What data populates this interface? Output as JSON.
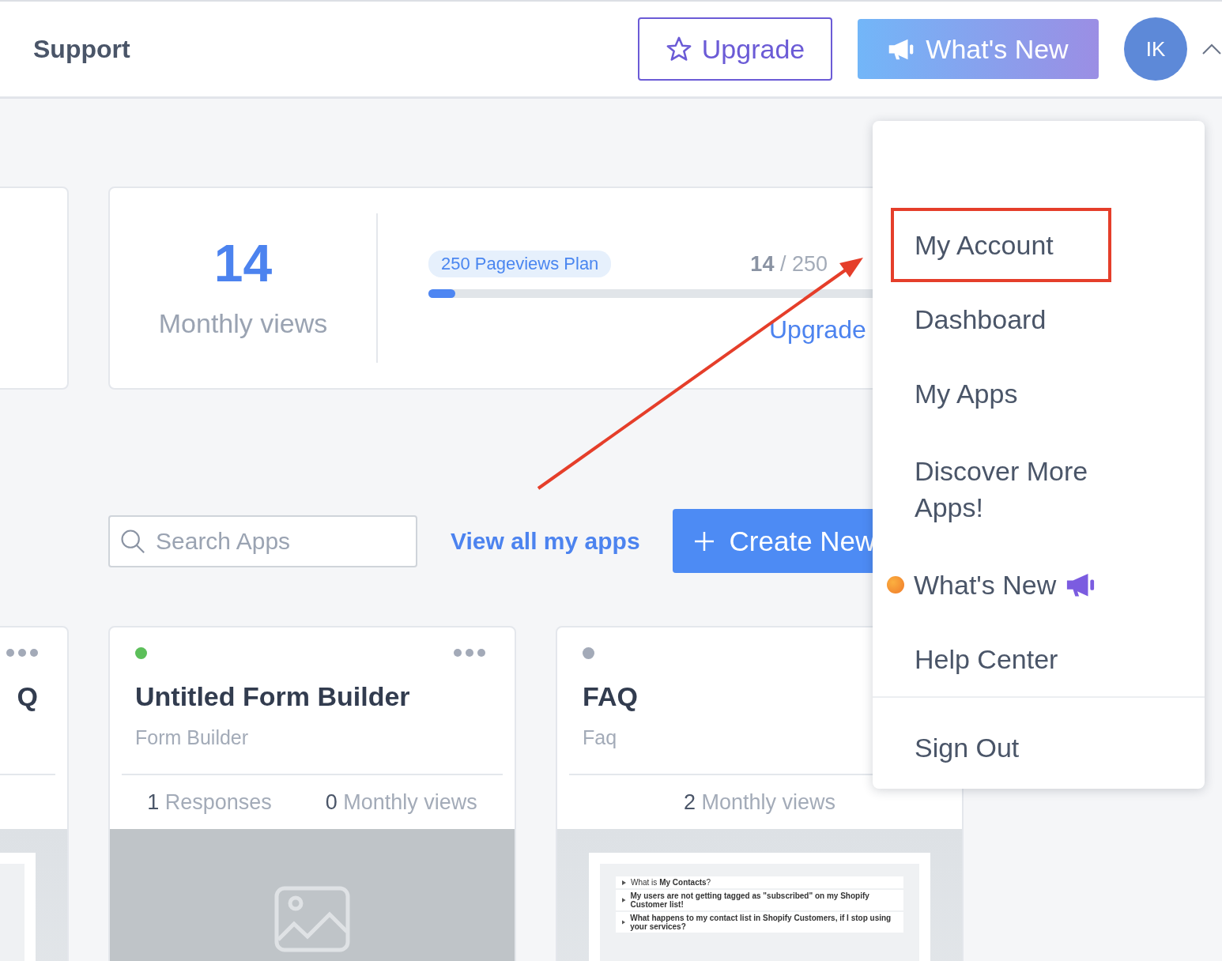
{
  "header": {
    "title": "Support",
    "upgrade_button": "Upgrade",
    "whats_new_button": "What's New",
    "avatar": "IK"
  },
  "plan_card": {
    "count": "14",
    "count_label": "Monthly views",
    "plan": "250 Pageviews Plan",
    "usage": "**14** / 250",
    "level": 0.056,
    "upgrade_link": "Upgrade"
  },
  "toolbar": {
    "search_placeholder": "Search Apps",
    "view_all_link": "View all my apps",
    "create_button": "Create New"
  },
  "apps": [
    {
      "kind": "partial",
      "title": "Q"
    },
    {
      "kind": "image",
      "color": "#5cbf5a",
      "title": "Untitled Form Builder",
      "type": "Form Builder",
      "stats": [
        {
          "value": "1",
          "label": "Responses"
        },
        {
          "value": "0",
          "label": "Monthly views"
        }
      ]
    },
    {
      "kind": "document",
      "color": "#a3aab8",
      "title": "FAQ",
      "type": "Faq",
      "stats": [
        {
          "value": "2",
          "label": "Monthly views"
        }
      ],
      "preview_items": [
        "What is **My Contacts**?",
        "**My users are not getting tagged as \"subscribed\" on my Shopify Customer list!**",
        "**What happens to my contact list in Shopify Customers, if I stop using your services?**"
      ]
    }
  ],
  "menu": {
    "items": [
      {
        "label": "My Account",
        "kind": "link",
        "highlighted": true
      },
      {
        "label": "Dashboard",
        "kind": "link",
        "highlighted": false
      },
      {
        "label": "My Apps",
        "kind": "link",
        "highlighted": false
      },
      {
        "label": "Discover More Apps!",
        "kind": "link",
        "highlighted": false
      },
      {
        "label": "What's New",
        "kind": "news",
        "highlighted": false
      },
      {
        "label": "Help Center",
        "kind": "link",
        "highlighted": false
      }
    ],
    "footer_item": "Sign Out"
  }
}
